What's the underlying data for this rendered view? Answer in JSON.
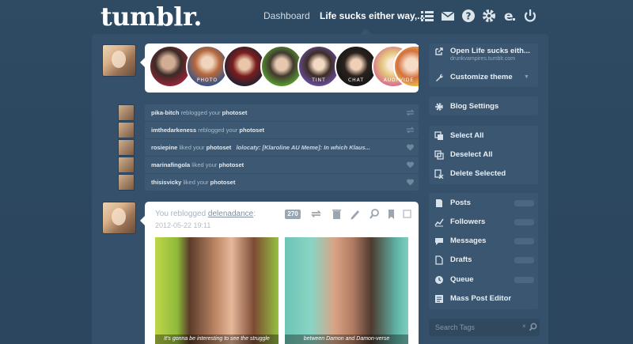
{
  "header": {
    "logo": "tumblr.",
    "nav_dashboard": "Dashboard",
    "nav_blog": "Life sucks either way,..."
  },
  "circles": [
    {
      "label": ""
    },
    {
      "label": "PHOTO"
    },
    {
      "label": ""
    },
    {
      "label": ""
    },
    {
      "label": "TINT"
    },
    {
      "label": "CHAT"
    },
    {
      "label": "AUDIO"
    },
    {
      "label": "VIDE"
    }
  ],
  "activity": [
    {
      "user": "pika-bitch",
      "action": "reblogged your",
      "object": "photoset",
      "extra": ""
    },
    {
      "user": "imthedarkeness",
      "action": "reblogged your",
      "object": "photoset",
      "extra": ""
    },
    {
      "user": "rosiepine",
      "action": "liked your",
      "object": "photoset",
      "extra": "lolocaty: [Klaroline AU Meme]: In which Klaus..."
    },
    {
      "user": "marinafingola",
      "action": "liked your",
      "object": "photoset",
      "extra": ""
    },
    {
      "user": "thisisvicky",
      "action": "liked your",
      "object": "photoset",
      "extra": ""
    }
  ],
  "post": {
    "prefix": "You reblogged",
    "source": "delenadance",
    "suffix": ":",
    "date": "2012-05-22 19:11",
    "notes": "270",
    "caption_left": "It's gonna be interesting to see the struggle",
    "caption_right": "between Damon and Damon-verse"
  },
  "sidebar": {
    "open_blog": "Open Life sucks eith...",
    "open_blog_url": "drunkvampires.tumblr.com",
    "customize": "Customize theme",
    "blog_settings": "Blog Settings",
    "select_all": "Select All",
    "deselect_all": "Deselect All",
    "delete_selected": "Delete Selected",
    "posts": "Posts",
    "followers": "Followers",
    "messages": "Messages",
    "drafts": "Drafts",
    "queue": "Queue",
    "mass_editor": "Mass Post Editor"
  },
  "search": {
    "placeholder": "Search Tags"
  },
  "colors": {
    "background": "#2f4a63",
    "panel": "#34506a",
    "accent": "#fff"
  }
}
